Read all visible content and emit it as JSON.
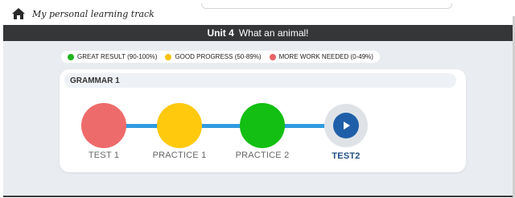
{
  "header": {
    "title": "My personal learning track",
    "home_icon": "home-icon"
  },
  "unit_bar": {
    "unit": "Unit 4",
    "title": "What an animal!"
  },
  "legend": {
    "items": [
      {
        "label": "GREAT RESULT (90-100%)",
        "color": "#22b31f"
      },
      {
        "label": "GOOD PROGRESS (50-89%)",
        "color": "#f5c200"
      },
      {
        "label": "MORE WORK NEEDED (0-49%)",
        "color": "#e86466"
      }
    ]
  },
  "card": {
    "title": "GRAMMAR 1",
    "nodes": [
      {
        "label": "TEST 1",
        "color": "#ee6b6b",
        "status": "more-work-needed"
      },
      {
        "label": "PRACTICE 1",
        "color": "#ffc90e",
        "status": "good-progress"
      },
      {
        "label": "PRACTICE 2",
        "color": "#12bf12",
        "status": "great-result"
      },
      {
        "label": "TEST2",
        "color": "#1f5ea8",
        "status": "current",
        "icon": "play-icon"
      }
    ]
  }
}
